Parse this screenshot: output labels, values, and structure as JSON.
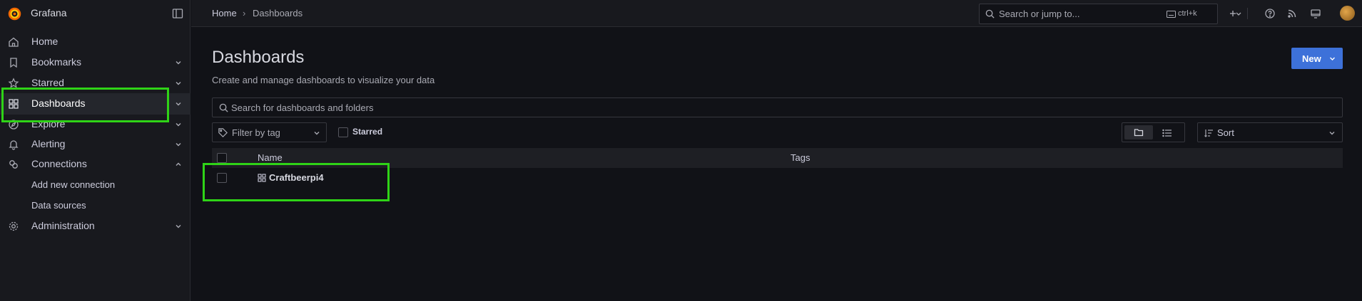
{
  "brand": {
    "name": "Grafana"
  },
  "nav": [
    {
      "label": "Home",
      "icon": "home-icon",
      "chevron": false
    },
    {
      "label": "Bookmarks",
      "icon": "bookmark-icon",
      "chevron": true
    },
    {
      "label": "Starred",
      "icon": "star-icon",
      "chevron": true
    },
    {
      "label": "Dashboards",
      "icon": "apps-icon",
      "chevron": true,
      "active": true
    },
    {
      "label": "Explore",
      "icon": "compass-icon",
      "chevron": true
    },
    {
      "label": "Alerting",
      "icon": "bell-icon",
      "chevron": true
    },
    {
      "label": "Connections",
      "icon": "link-icon",
      "chevron": true,
      "expanded": true
    },
    {
      "label": "Administration",
      "icon": "cog-icon",
      "chevron": true
    }
  ],
  "connections_sub": [
    "Add new connection",
    "Data sources"
  ],
  "breadcrumb": {
    "home": "Home",
    "separator": "›",
    "current": "Dashboards"
  },
  "top_search": {
    "placeholder": "Search or jump to...",
    "shortcut": "ctrl+k"
  },
  "page": {
    "title": "Dashboards",
    "subtitle": "Create and manage dashboards to visualize your data",
    "new_button": "New"
  },
  "search": {
    "placeholder": "Search for dashboards and folders"
  },
  "filters": {
    "tag_placeholder": "Filter by tag",
    "starred_label": "Starred",
    "sort_placeholder": "Sort"
  },
  "table": {
    "columns": {
      "name": "Name",
      "tags": "Tags"
    },
    "rows": [
      {
        "name": "Craftbeerpi4",
        "tags": ""
      }
    ]
  },
  "colors": {
    "accent": "#3d71d9",
    "highlight": "#2fd317",
    "background": "#111217",
    "sidebar": "#18191e"
  }
}
